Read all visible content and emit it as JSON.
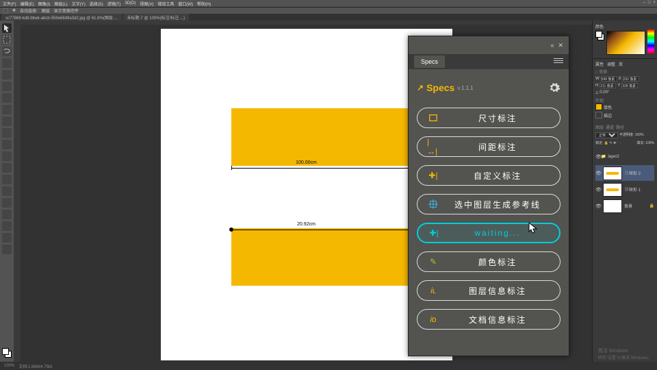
{
  "menu": {
    "items": [
      "文件(F)",
      "编辑(E)",
      "图像(I)",
      "图层(L)",
      "文字(Y)",
      "选择(S)",
      "滤镜(T)",
      "3D(D)",
      "视图(V)",
      "增效工具",
      "窗口(W)",
      "帮助(H)"
    ]
  },
  "wincontrols": {
    "min": "–",
    "max": "□",
    "close": "×"
  },
  "optbar": {
    "autoSel": "自动选择:",
    "selMode": "图层",
    "showTrans": "显示变换控件"
  },
  "tabs": {
    "t1": "sc77869-kd8.tblwk-abcb-559e68d9a3d2.jpg @ 61.8%(图层 ...",
    "t2": "未标题-7 @ 100%(标注/标注 ...)"
  },
  "canvas": {
    "dim1": "100.00cm",
    "dim2": "20.92cm"
  },
  "specs": {
    "tab": "Specs",
    "title": "Specs",
    "version": "v.1.1.1",
    "buttons": [
      {
        "label": "尺寸标注"
      },
      {
        "label": "间距标注"
      },
      {
        "label": "自定义标注"
      },
      {
        "label": "选中图层生成参考线"
      },
      {
        "label": "waiting..."
      },
      {
        "label": "颜色标注"
      },
      {
        "label": "图层信息标注"
      },
      {
        "label": "文档信息标注"
      }
    ]
  },
  "right": {
    "colorTab": "颜色",
    "propTab": "属性",
    "libTab": "库",
    "adjTab": "调整",
    "wVal": "598 像素",
    "hVal": "211 像素",
    "xVal": "292 像素",
    "yVal": "328 像素",
    "fx": "外观",
    "fill": "填色",
    "layersTab": "图层",
    "chanTab": "通道",
    "pathTab": "路径",
    "opac": "不透明度: 100%",
    "fillOp": "填充: 100%",
    "blend": "正常",
    "group": "layer2",
    "layerA": "矩形 2",
    "layerB": "矩形 1",
    "layerBg": "背景"
  },
  "status": {
    "zoom": "100%",
    "doc": "文档:2.86M/4.75M"
  },
  "watermark": {
    "l1": "激活 Windows",
    "l2": "转到\"设置\"以激活 Windows。"
  }
}
